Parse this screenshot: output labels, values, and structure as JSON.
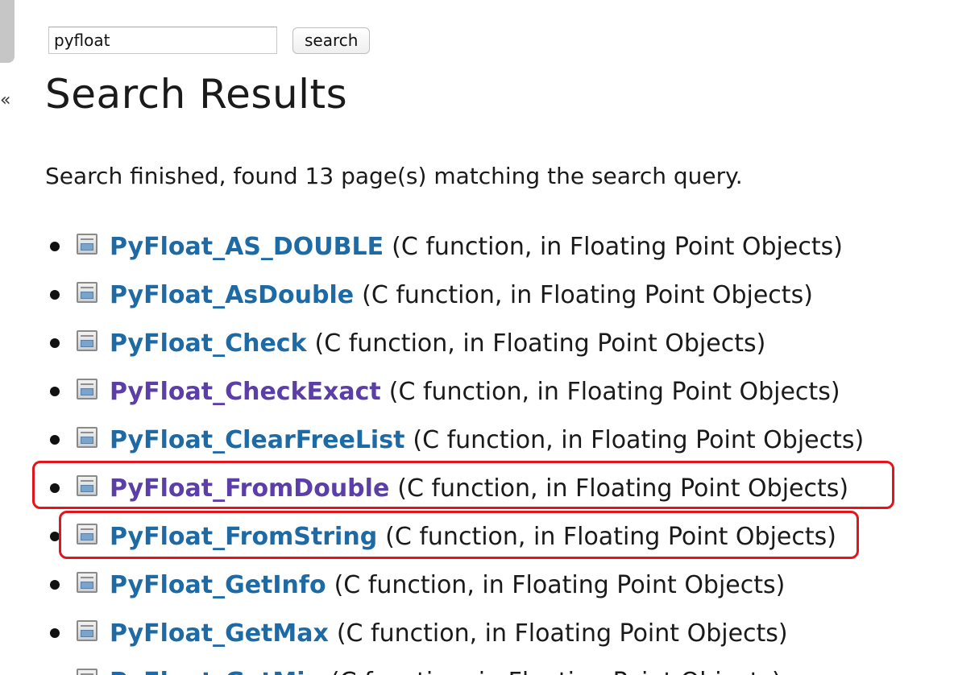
{
  "search": {
    "value": "pyfloat",
    "button_label": "search"
  },
  "sidebar": {
    "collapse_label": "«"
  },
  "page": {
    "title": "Search Results",
    "summary": "Search finished, found 13 page(s) matching the search query."
  },
  "results": [
    {
      "name": "PyFloat_AS_DOUBLE",
      "desc": "(C function, in Floating Point Objects)",
      "visited": false
    },
    {
      "name": "PyFloat_AsDouble",
      "desc": "(C function, in Floating Point Objects)",
      "visited": false
    },
    {
      "name": "PyFloat_Check",
      "desc": "(C function, in Floating Point Objects)",
      "visited": false
    },
    {
      "name": "PyFloat_CheckExact",
      "desc": "(C function, in Floating Point Objects)",
      "visited": true
    },
    {
      "name": "PyFloat_ClearFreeList",
      "desc": "(C function, in Floating Point Objects)",
      "visited": false
    },
    {
      "name": "PyFloat_FromDouble",
      "desc": "(C function, in Floating Point Objects)",
      "visited": true
    },
    {
      "name": "PyFloat_FromString",
      "desc": "(C function, in Floating Point Objects)",
      "visited": false
    },
    {
      "name": "PyFloat_GetInfo",
      "desc": "(C function, in Floating Point Objects)",
      "visited": false
    },
    {
      "name": "PyFloat_GetMax",
      "desc": "(C function, in Floating Point Objects)",
      "visited": false
    },
    {
      "name": "PyFloat_GetMin",
      "desc": "(C function, in Floating Point Objects)",
      "visited": false
    }
  ],
  "colors": {
    "link": "#1d6aa5",
    "visited_link": "#5b3ea8",
    "highlight": "#e3141b"
  }
}
